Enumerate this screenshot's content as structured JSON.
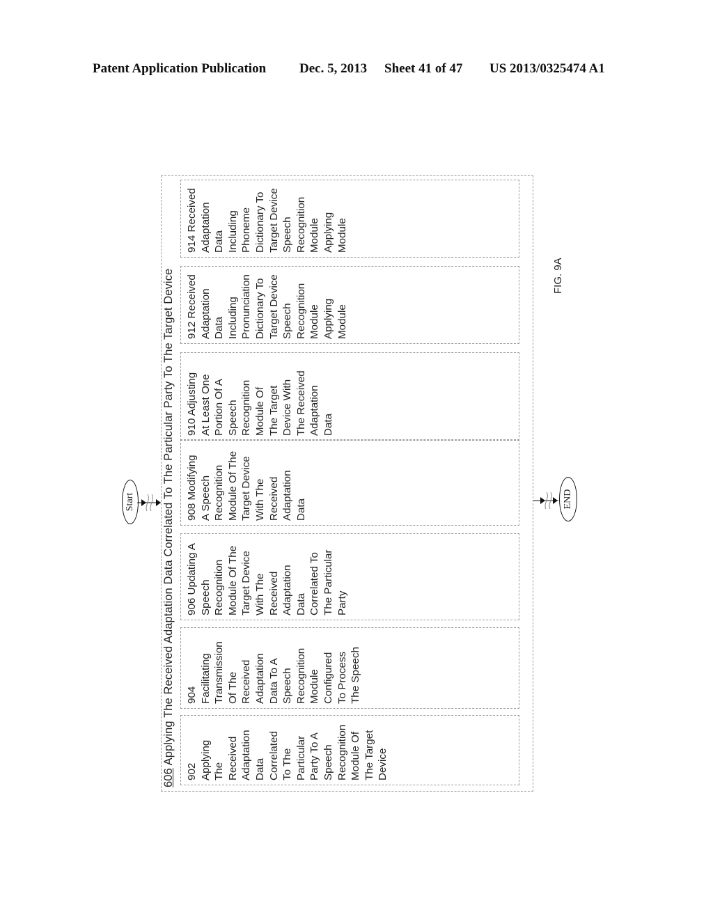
{
  "header": {
    "publication": "Patent Application Publication",
    "date": "Dec. 5, 2013",
    "sheet": "Sheet 41 of 47",
    "number": "US 2013/0325474 A1"
  },
  "diagram": {
    "outer": {
      "ref": "606",
      "title": " Applying The Received Adaptation Data Correlated To The Particular Party To The Target Device"
    },
    "start_label": "Start",
    "end_label": "END",
    "figure_label": "FIG. 9A",
    "steps": [
      {
        "id": "902",
        "lines": [
          "902",
          "Applying",
          "The",
          "Received",
          "Adaptation",
          "Data",
          "Correlated",
          "To The",
          "Particular",
          "Party To A",
          "Speech",
          "Recognition",
          "Module Of",
          "The Target",
          "Device"
        ]
      },
      {
        "id": "904",
        "lines": [
          "904",
          "Facilitating",
          "Transmission",
          "Of The",
          "Received",
          "Adaptation",
          "Data To A",
          "Speech",
          "Recognition",
          "Module",
          "Configured",
          "To Process",
          "The Speech"
        ]
      },
      {
        "id": "906",
        "lines": [
          "906 Updating A",
          "Speech",
          "Recognition",
          "Module Of The",
          "Target Device",
          "With The",
          "Received",
          "Adaptation",
          "Data",
          "Correlated To",
          "The Particular",
          "Party"
        ]
      },
      {
        "id": "908",
        "lines": [
          "908 Modifying",
          "A Speech",
          "Recognition",
          "Module Of The",
          "Target Device",
          "With The",
          "Received",
          "Adaptation",
          "Data"
        ]
      },
      {
        "id": "910",
        "lines": [
          "910 Adjusting",
          "At Least One",
          "Portion Of A",
          "Speech",
          "Recognition",
          "Module Of",
          "The Target",
          "Device With",
          "The Received",
          "Adaptation",
          "Data"
        ]
      },
      {
        "id": "912",
        "lines": [
          "912 Received",
          "Adaptation",
          "Data",
          "Including",
          "Pronunciation",
          "Dictionary To",
          "Target Device",
          "Speech",
          "Recognition",
          "Module",
          "Applying",
          "Module"
        ]
      },
      {
        "id": "914",
        "lines": [
          "914 Received",
          "Adaptation",
          "Data",
          "Including",
          "Phoneme",
          "Dictionary To",
          "Target Device",
          "Speech",
          "Recognition",
          "Module",
          "Applying",
          "Module"
        ]
      }
    ]
  }
}
